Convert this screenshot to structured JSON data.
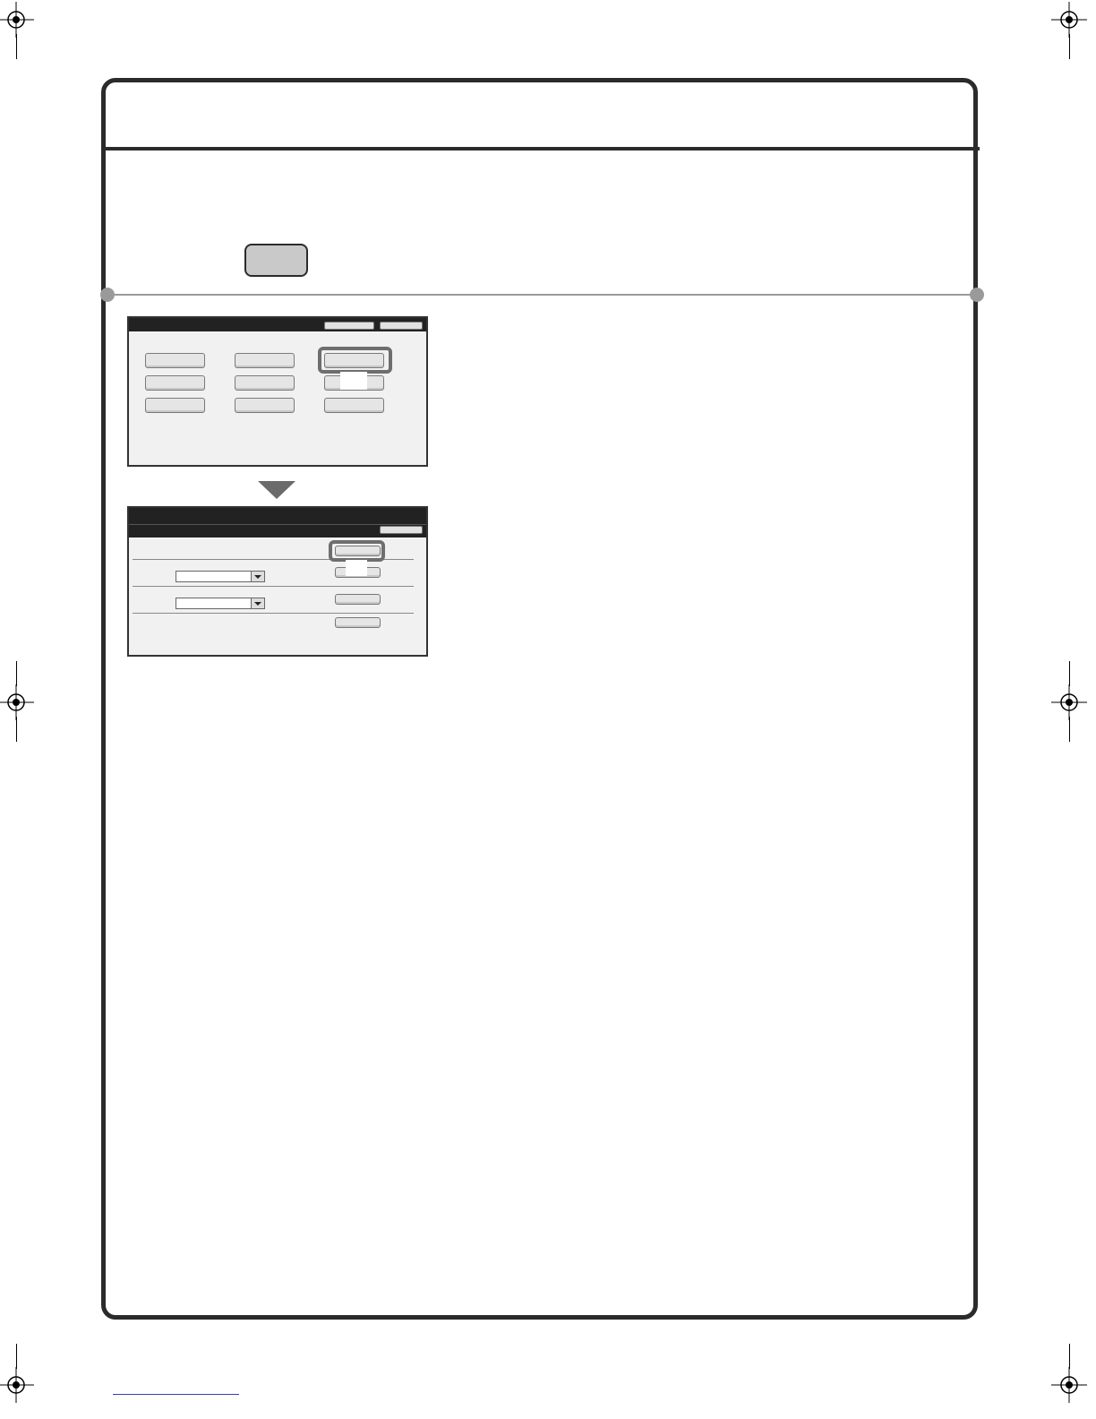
{
  "document": {
    "registration_mark_icon": "crosshair-registration-mark"
  },
  "colors": {
    "frame": "#2b2b2b",
    "panel_bg": "#f1f1f1",
    "highlight": "#6e6e6e",
    "key_button": "#c9c9c9",
    "link": "#3344aa"
  }
}
